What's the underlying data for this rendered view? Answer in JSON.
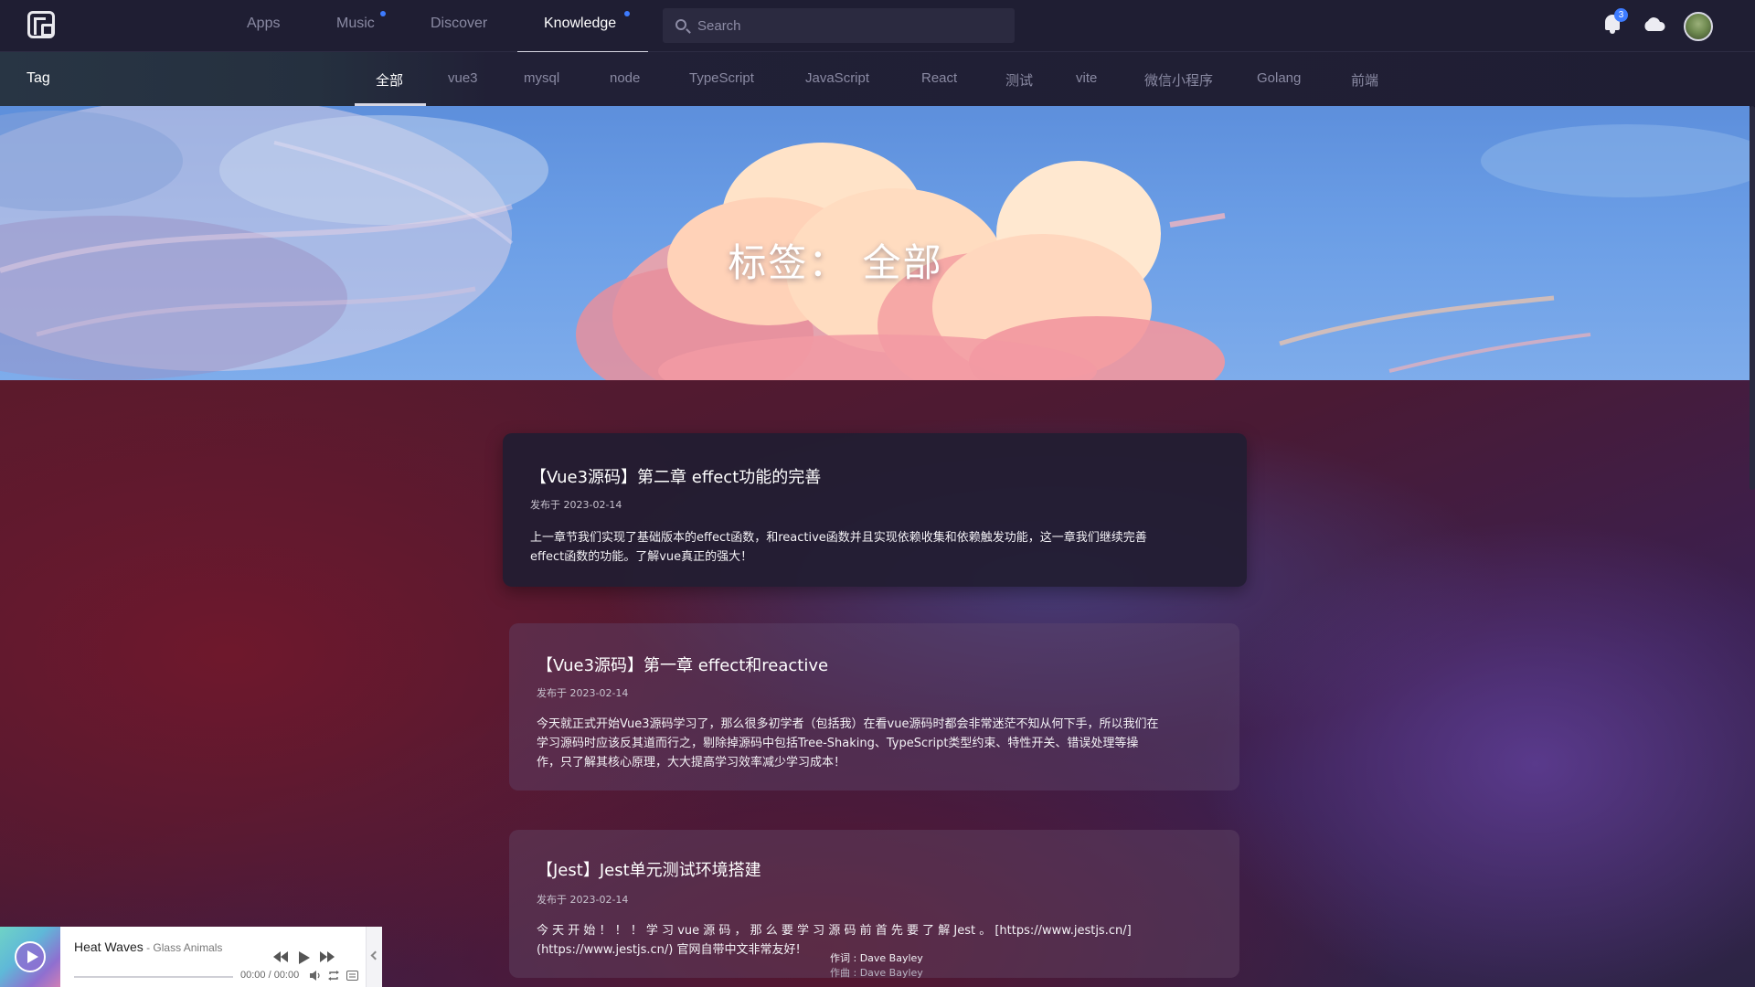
{
  "topnav": {
    "items": [
      {
        "label": "Apps"
      },
      {
        "label": "Music"
      },
      {
        "label": "Discover"
      },
      {
        "label": "Knowledge"
      }
    ],
    "search_placeholder": "Search",
    "notification_count": "3"
  },
  "tagbar": {
    "title": "Tag",
    "tags": [
      {
        "label": "全部"
      },
      {
        "label": "vue3"
      },
      {
        "label": "mysql"
      },
      {
        "label": "node"
      },
      {
        "label": "TypeScript"
      },
      {
        "label": "JavaScript"
      },
      {
        "label": "React"
      },
      {
        "label": "测试"
      },
      {
        "label": "vite"
      },
      {
        "label": "微信小程序"
      },
      {
        "label": "Golang"
      },
      {
        "label": "前端"
      }
    ]
  },
  "hero": {
    "title": "标签： 全部"
  },
  "articles": [
    {
      "title": "【Vue3源码】第二章 effect功能的完善",
      "date": "发布于 2023-02-14",
      "lines": [
        "上一章节我们实现了基础版本的effect函数，和reactive函数并且实现依赖收集和依赖触发功能，这一章我们继续完善",
        "effect函数的功能。了解vue真正的强大！"
      ]
    },
    {
      "title": "【Vue3源码】第一章 effect和reactive",
      "date": "发布于 2023-02-14",
      "lines": [
        "今天就正式开始Vue3源码学习了，那么很多初学者（包括我）在看vue源码时都会非常迷茫不知从何下手，所以我们在",
        "学习源码时应该反其道而行之，剔除掉源码中包括Tree-Shaking、TypeScript类型约束、特性开关、错误处理等操",
        "作，只了解其核心原理，大大提高学习效率减少学习成本！"
      ]
    },
    {
      "title": "【Jest】Jest单元测试环境搭建",
      "date": "发布于 2023-02-14",
      "lines": [
        "今 天 开 始 ！ ！ ！ 学 习 vue 源 码 ， 那 么 要 学 习 源 码 前 首 先 要 了 解 Jest 。 [https://www.jestjs.cn/]",
        "(https://www.jestjs.cn/) 官网自带中文非常友好!"
      ]
    }
  ],
  "lyrics": {
    "line1": "作词 : Dave Bayley",
    "line2": "作曲 : Dave Bayley"
  },
  "player": {
    "song": "Heat Waves",
    "separator": " - ",
    "artist": "Glass Animals",
    "time": "00:00 / 00:00",
    "progress": 0
  },
  "colors": {
    "accent": "#3d7bff",
    "nav_bg": "#1f1e33"
  }
}
